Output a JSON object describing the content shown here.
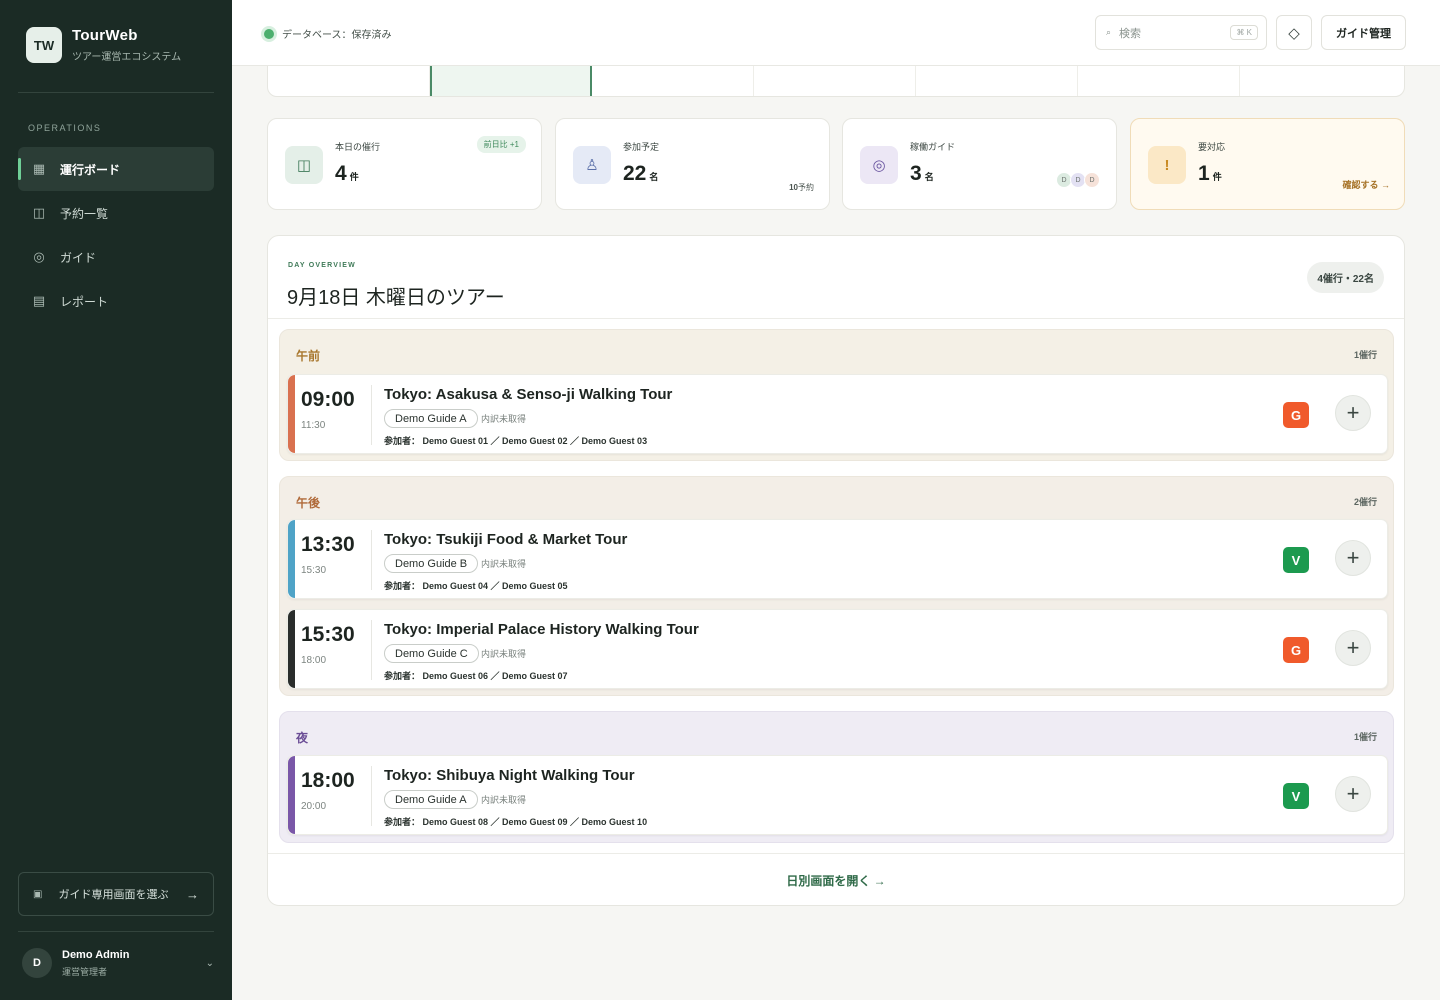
{
  "brand": {
    "logo": "TW",
    "name": "TourWeb",
    "subtitle": "ツアー運営エコシステム"
  },
  "sidebar": {
    "section": "OPERATIONS",
    "items": [
      {
        "label": "運行ボード",
        "icon": "grid-icon",
        "glyph": "▦",
        "active": true
      },
      {
        "label": "予約一覧",
        "icon": "columns-icon",
        "glyph": "◫",
        "active": false
      },
      {
        "label": "ガイド",
        "icon": "target-icon",
        "glyph": "◎",
        "active": false
      },
      {
        "label": "レポート",
        "icon": "report-icon",
        "glyph": "▤",
        "active": false
      }
    ],
    "guide_select": {
      "label": "ガイド専用画面を選ぶ",
      "icon_glyph": "▣",
      "arrow": "→"
    },
    "user": {
      "initial": "D",
      "name": "Demo Admin",
      "role": "運営管理者",
      "chevron": "⌄"
    }
  },
  "topbar": {
    "db_status": "データベース：保存済み",
    "search": {
      "placeholder": "検索",
      "icon_glyph": "⌕",
      "shortcut": "⌘ K"
    },
    "diamond_glyph": "◇",
    "guide_button": "ガイド管理"
  },
  "stats": [
    {
      "label": "本日の催行",
      "value": "4",
      "unit": "件",
      "badge": "前日比 +1",
      "icon": "columns-icon",
      "glyph": "◫"
    },
    {
      "label": "参加予定",
      "value": "22",
      "unit": "名",
      "note_value": "10",
      "note_unit": "予約",
      "icon": "person-icon",
      "glyph": "♙"
    },
    {
      "label": "稼働ガイド",
      "value": "3",
      "unit": "名",
      "avatars": [
        "D",
        "D",
        "D"
      ],
      "icon": "target-icon",
      "glyph": "◎"
    },
    {
      "label": "要対応",
      "value": "1",
      "unit": "件",
      "link": "確認する →",
      "icon": "alert-icon",
      "glyph": "!"
    }
  ],
  "day": {
    "kicker": "DAY OVERVIEW",
    "title": "9月18日 木曜日のツアー",
    "summary": "4催行・22名",
    "open_label": "日別画面を開く →"
  },
  "groups": [
    {
      "label": "午前",
      "count": "1催行",
      "tours": [
        {
          "start": "09:00",
          "end": "11:30",
          "name": "Tokyo: Asakusa & Senso-ji Walking Tour",
          "guide": "Demo Guide A",
          "status": "内訳未取得",
          "participants": "参加者： Demo Guest 01 ／ Demo Guest 02 ／ Demo Guest 03",
          "platform": "G",
          "bar_color": "#d9714f",
          "platform_color": "#f05a2b"
        }
      ]
    },
    {
      "label": "午後",
      "count": "2催行",
      "tours": [
        {
          "start": "13:30",
          "end": "15:30",
          "name": "Tokyo: Tsukiji Food & Market Tour",
          "guide": "Demo Guide B",
          "status": "内訳未取得",
          "participants": "参加者： Demo Guest 04 ／ Demo Guest 05",
          "platform": "V",
          "bar_color": "#4fa3c7",
          "platform_color": "#1c9a4f"
        },
        {
          "start": "15:30",
          "end": "18:00",
          "name": "Tokyo: Imperial Palace History Walking Tour",
          "guide": "Demo Guide C",
          "status": "内訳未取得",
          "participants": "参加者： Demo Guest 06 ／ Demo Guest 07",
          "platform": "G",
          "bar_color": "#2a2d2c",
          "platform_color": "#f05a2b"
        }
      ]
    },
    {
      "label": "夜",
      "count": "1催行",
      "tours": [
        {
          "start": "18:00",
          "end": "20:00",
          "name": "Tokyo: Shibuya Night Walking Tour",
          "guide": "Demo Guide A",
          "status": "内訳未取得",
          "participants": "参加者： Demo Guest 08 ／ Demo Guest 09 ／ Demo Guest 10",
          "platform": "V",
          "bar_color": "#7a57a8",
          "platform_color": "#1c9a4f"
        }
      ]
    }
  ],
  "add_glyph": "+"
}
